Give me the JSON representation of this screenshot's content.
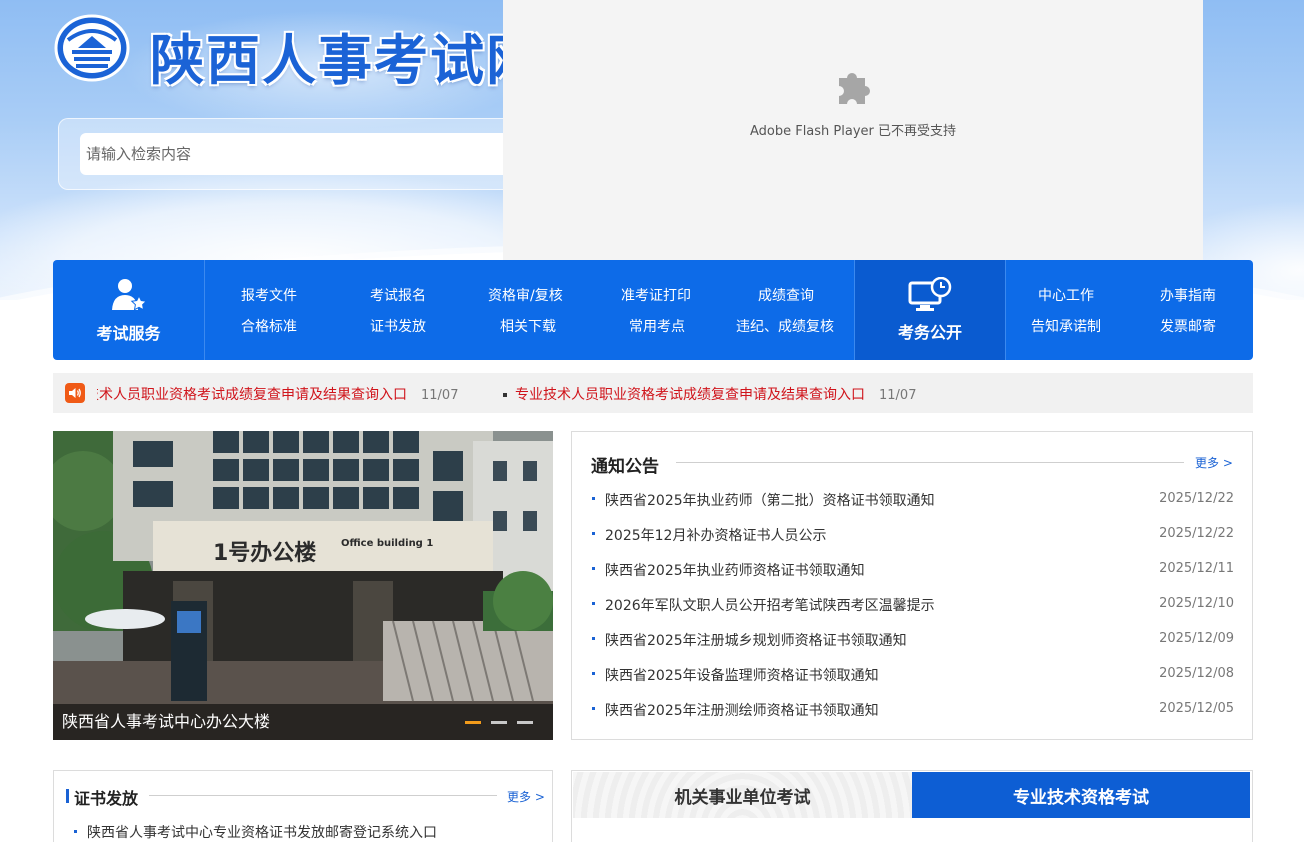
{
  "site": {
    "title": "陕西人事考试网"
  },
  "search": {
    "placeholder": "请输入检索内容"
  },
  "flash": {
    "message": "Adobe Flash Player 已不再受支持"
  },
  "nav": {
    "exam_service": {
      "label": "考试服务",
      "links": [
        "报考文件",
        "考试报名",
        "资格审/复核",
        "准考证打印",
        "成绩查询",
        "合格标准",
        "证书发放",
        "相关下载",
        "常用考点",
        "违纪、成绩复核"
      ]
    },
    "affairs": {
      "label": "考务公开",
      "links": [
        "中心工作",
        "办事指南",
        "告知承诺制",
        "发票邮寄"
      ]
    }
  },
  "ticker": {
    "items": [
      {
        "title": "专业技术人员职业资格考试成绩复查申请及结果查询入口",
        "date": "11/07"
      },
      {
        "title": "专业技术人员职业资格考试成绩复查申请及结果查询入口",
        "date": "11/07"
      }
    ]
  },
  "photo": {
    "caption": "陕西省人事考试中心办公大楼",
    "building_sign": "1号办公楼",
    "building_sign_en": "Office building 1"
  },
  "notice": {
    "title": "通知公告",
    "more": "更多 >",
    "items": [
      {
        "title": "陕西省2025年执业药师（第二批）资格证书领取通知",
        "date": "2025/12/22"
      },
      {
        "title": "2025年12月补办资格证书人员公示",
        "date": "2025/12/22"
      },
      {
        "title": "陕西省2025年执业药师资格证书领取通知",
        "date": "2025/12/11"
      },
      {
        "title": "2026年军队文职人员公开招考笔试陕西考区温馨提示",
        "date": "2025/12/10"
      },
      {
        "title": "陕西省2025年注册城乡规划师资格证书领取通知",
        "date": "2025/12/09"
      },
      {
        "title": "陕西省2025年设备监理师资格证书领取通知",
        "date": "2025/12/08"
      },
      {
        "title": "陕西省2025年注册测绘师资格证书领取通知",
        "date": "2025/12/05"
      }
    ]
  },
  "cert": {
    "title": "证书发放",
    "more": "更多 >",
    "items": [
      "陕西省人事考试中心专业资格证书发放邮寄登记系统入口"
    ]
  },
  "exams": {
    "tabs": [
      "机关事业单位考试",
      "专业技术资格考试"
    ],
    "active": 1
  },
  "colors": {
    "primary": "#0d6be8",
    "ticker_text": "#d0141b",
    "accent": "#f29b1b"
  }
}
